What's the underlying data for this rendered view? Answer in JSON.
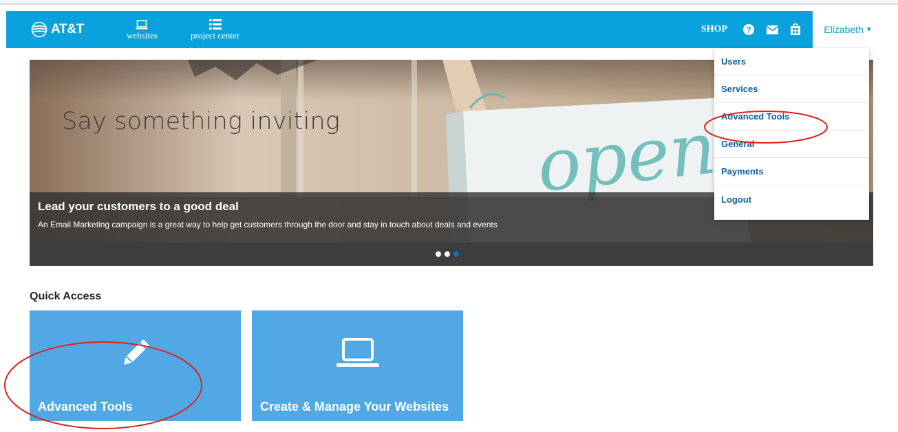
{
  "header": {
    "brand": "AT&T",
    "nav": [
      {
        "label": "websites",
        "icon": "laptop-icon"
      },
      {
        "label": "project center",
        "icon": "list-icon"
      }
    ],
    "shop": "SHOP",
    "icons": [
      "help-icon",
      "mail-icon",
      "store-icon"
    ],
    "user": "Elizabeth",
    "colors": {
      "bar": "#0aa2dd",
      "link": "#0a5e9c"
    }
  },
  "hero": {
    "title": "Say something inviting",
    "caption_title": "Lead your customers to a good deal",
    "caption_text": "An Email Marketing campaign is a great way to help get customers through the door and stay in touch about deals and events",
    "sign_text": "open",
    "slides": 3,
    "active_slide": 3
  },
  "user_menu": {
    "items": [
      "Users",
      "Services",
      "Advanced Tools",
      "General",
      "Payments",
      "Logout"
    ]
  },
  "quick_access": {
    "title": "Quick Access",
    "tiles": [
      {
        "label": "Advanced Tools",
        "icon": "pencil-icon"
      },
      {
        "label": "Create & Manage Your Websites",
        "icon": "laptop-icon"
      }
    ]
  }
}
